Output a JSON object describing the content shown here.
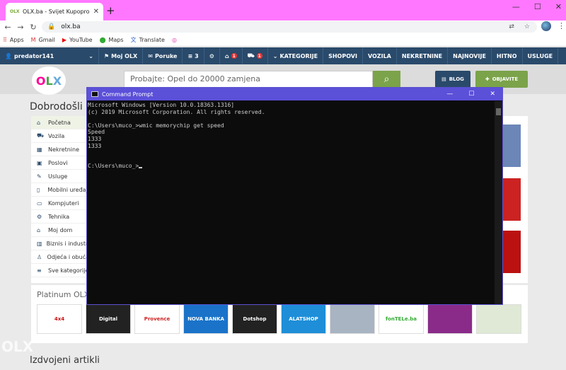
{
  "browser": {
    "tab_title": "OLX.ba - Svijet Kupoprodaje",
    "tab_favicon_text": "OLX",
    "url": "olx.ba",
    "bookmarks": [
      "Apps",
      "Gmail",
      "YouTube",
      "Maps",
      "Translate"
    ]
  },
  "olx_nav": {
    "user": "predator141",
    "moj_olx": "Moj OLX",
    "poruke": "Poruke",
    "count": "3",
    "badge1": "1",
    "badge2": "1",
    "items": [
      "KATEGORIJE",
      "SHOPOVI",
      "VOZILA",
      "NEKRETNINE",
      "NAJNOVIJE",
      "HITNO",
      "USLUGE"
    ]
  },
  "header": {
    "search_placeholder": "Probajte: Opel do 20000 zamjena",
    "blog": "BLOG",
    "objavite": "OBJAVITE"
  },
  "page": {
    "welcome": "Dobrodošli n",
    "sidebar": [
      {
        "label": "Početna",
        "icon": "home-icon"
      },
      {
        "label": "Vozila",
        "icon": "car-icon"
      },
      {
        "label": "Nekretnine",
        "icon": "building-icon"
      },
      {
        "label": "Poslovi",
        "icon": "briefcase-icon"
      },
      {
        "label": "Usluge",
        "icon": "wrench-icon"
      },
      {
        "label": "Mobilni uređaji",
        "icon": "phone-icon"
      },
      {
        "label": "Kompjuteri",
        "icon": "monitor-icon"
      },
      {
        "label": "Tehnika",
        "icon": "gear-icon"
      },
      {
        "label": "Moj dom",
        "icon": "house-icon"
      },
      {
        "label": "Biznis i industrija",
        "icon": "factory-icon"
      },
      {
        "label": "Odjeća i obuća",
        "icon": "shirt-icon"
      },
      {
        "label": "Sve kategorije",
        "icon": "menu-icon"
      }
    ],
    "platinum_title": "Platinum OLX S",
    "platinum_logos": [
      "4x4",
      "Digital",
      "Provence",
      "NOVA BANKA",
      "Dotshop",
      "ALATSHOP",
      "",
      "fonTELe.ba",
      "",
      ""
    ],
    "izdvojeni": "Izdvojeni artikli",
    "watermark": "OLX"
  },
  "cmd": {
    "title": "Command Prompt",
    "lines": [
      "Microsoft Windows [Version 10.0.18363.1316]",
      "(c) 2019 Microsoft Corporation. All rights reserved.",
      "",
      "C:\\Users\\muco_>wmic memorychip get speed",
      "Speed",
      "1333",
      "1333",
      "",
      "",
      "C:\\Users\\muco_>"
    ]
  },
  "colors": {
    "tabstrip": "#ff77ff",
    "olx_nav": "#2a4a6b",
    "olx_green": "#7ba34a",
    "cmd_title": "#5b50d8"
  }
}
